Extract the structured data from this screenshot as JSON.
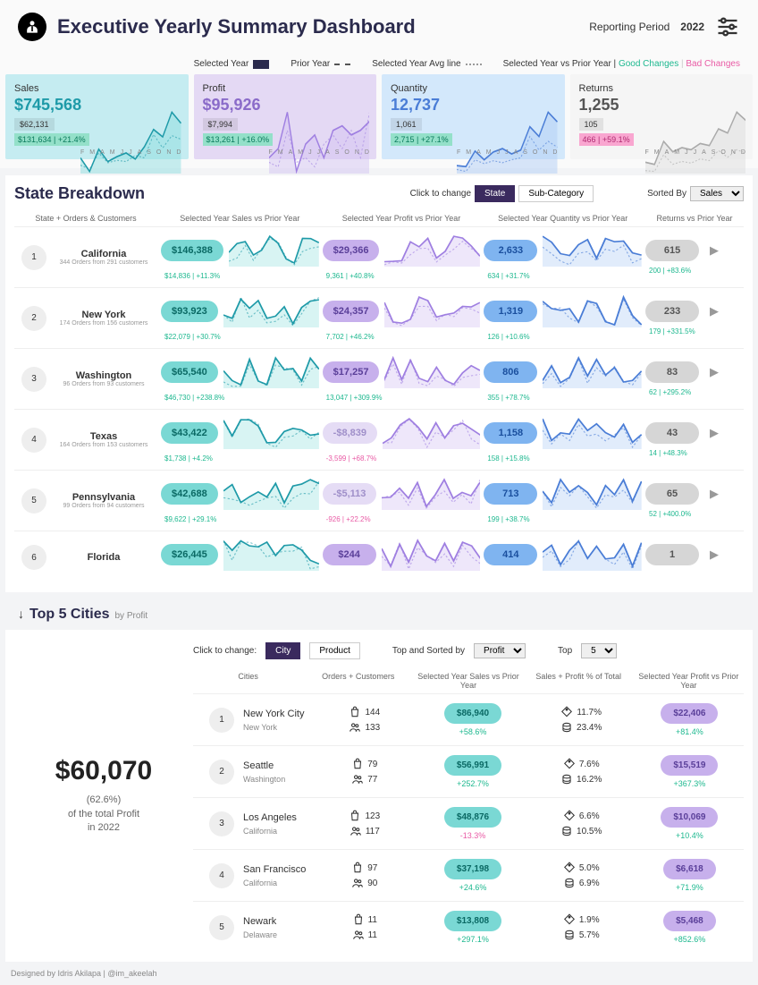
{
  "header": {
    "title": "Executive Yearly Summary Dashboard",
    "period_label": "Reporting Period",
    "period_year": "2022"
  },
  "legend": {
    "sel": "Selected Year",
    "prior": "Prior Year",
    "avg": "Selected Year Avg line",
    "svp_label": "Selected Year vs Prior Year |",
    "good": "Good Changes",
    "bad": "Bad Changes"
  },
  "kpis": {
    "sales": {
      "label": "Sales",
      "value": "$745,568",
      "avg": "$62,131",
      "delta": "$131,634 | +21.4%",
      "delta_good": true,
      "color": "#1e9aa8",
      "area": "#8fdddf"
    },
    "profit": {
      "label": "Profit",
      "value": "$95,926",
      "avg": "$7,994",
      "delta": "$13,261 | +16.0%",
      "delta_good": true,
      "color": "#9f7fe1",
      "area": "#d3c4f2"
    },
    "qty": {
      "label": "Quantity",
      "value": "12,737",
      "avg": "1,061",
      "delta": "2,715 | +27.1%",
      "delta_good": true,
      "color": "#4a7dd6",
      "area": "#b2cef6"
    },
    "ret": {
      "label": "Returns",
      "value": "1,255",
      "avg": "105",
      "delta": "466 | +59.1%",
      "delta_good": false,
      "color": "#aaa",
      "area": "#ddd"
    }
  },
  "chart_data": {
    "kpi_sparklines": {
      "type": "line",
      "months": [
        "J",
        "F",
        "M",
        "A",
        "M",
        "J",
        "J",
        "A",
        "S",
        "O",
        "N",
        "D"
      ],
      "series": {
        "sales": {
          "current": [
            44,
            22,
            58,
            38,
            46,
            52,
            42,
            62,
            90,
            78,
            118,
            100
          ],
          "prior": [
            32,
            26,
            52,
            36,
            40,
            38,
            48,
            44,
            82,
            60,
            80,
            74
          ]
        },
        "profit": {
          "current": [
            4,
            6,
            14,
            1,
            7,
            9,
            4,
            10,
            11,
            9,
            10,
            12
          ],
          "prior": [
            3,
            2,
            10,
            3,
            4,
            2,
            7,
            9,
            6,
            10,
            4,
            14
          ]
        },
        "quantity": {
          "current": [
            600,
            580,
            900,
            720,
            880,
            950,
            840,
            920,
            1400,
            1200,
            1700,
            1500
          ],
          "prior": [
            520,
            480,
            720,
            640,
            700,
            660,
            720,
            760,
            1200,
            920,
            1100,
            980
          ]
        },
        "returns": {
          "current": [
            60,
            55,
            110,
            85,
            95,
            90,
            105,
            100,
            140,
            130,
            180,
            160
          ],
          "prior": [
            40,
            38,
            78,
            55,
            62,
            58,
            68,
            64,
            88,
            72,
            90,
            82
          ]
        }
      }
    },
    "state_rows_sparklines_note": "monthly trends, relative shapes only"
  },
  "breakdown": {
    "title": "State  Breakdown",
    "ctc": "Click to change",
    "opt_state": "State",
    "opt_sub": "Sub-Category",
    "sort_label": "Sorted By",
    "sort_value": "Sales",
    "cols": {
      "c1": "State + Orders & Customers",
      "c2": "Selected Year Sales vs  Prior Year",
      "c3": "Selected Year Profit vs  Prior Year",
      "c4": "Selected Year Quantity vs Prior Year",
      "c5": "Returns vs Prior Year"
    },
    "rows": [
      {
        "rank": "1",
        "name": "California",
        "sub": "344 Orders from 291 customers",
        "sales": "$146,388",
        "sales_d": "$14,836 | +11.3%",
        "sg": true,
        "profit": "$29,366",
        "profit_d": "9,361 | +40.8%",
        "pg": true,
        "qty": "2,633",
        "qty_d": "634 | +31.7%",
        "qg": true,
        "ret": "615",
        "ret_d": "200 | +83.6%",
        "rg": true
      },
      {
        "rank": "2",
        "name": "New York",
        "sub": "174 Orders from 156 customers",
        "sales": "$93,923",
        "sales_d": "$22,079 | +30.7%",
        "sg": true,
        "profit": "$24,357",
        "profit_d": "7,702 | +46.2%",
        "pg": true,
        "qty": "1,319",
        "qty_d": "126 | +10.6%",
        "qg": true,
        "ret": "233",
        "ret_d": "179 | +331.5%",
        "rg": true
      },
      {
        "rank": "3",
        "name": "Washington",
        "sub": "96 Orders from 93 customers",
        "sales": "$65,540",
        "sales_d": "$46,730 | +238.8%",
        "sg": true,
        "profit": "$17,257",
        "profit_d": "13,047 | +309.9%",
        "pg": true,
        "qty": "806",
        "qty_d": "355 | +78.7%",
        "qg": true,
        "ret": "83",
        "ret_d": "62 | +295.2%",
        "rg": true
      },
      {
        "rank": "4",
        "name": "Texas",
        "sub": "164 Orders from 153 customers",
        "sales": "$43,422",
        "sales_d": "$1,738 | +4.2%",
        "sg": true,
        "profit": "-$8,839",
        "profit_d": "-3,599 | +68.7%",
        "pg": false,
        "pn": true,
        "qty": "1,158",
        "qty_d": "158 | +15.8%",
        "qg": true,
        "ret": "43",
        "ret_d": "14 | +48.3%",
        "rg": true
      },
      {
        "rank": "5",
        "name": "Pennsylvania",
        "sub": "99 Orders from 94 customers",
        "sales": "$42,688",
        "sales_d": "$9,622 | +29.1%",
        "sg": true,
        "profit": "-$5,113",
        "profit_d": "-926 | +22.2%",
        "pg": false,
        "pn": true,
        "qty": "713",
        "qty_d": "199 | +38.7%",
        "qg": true,
        "ret": "65",
        "ret_d": "52 | +400.0%",
        "rg": true
      },
      {
        "rank": "6",
        "name": "Florida",
        "sub": "",
        "sales": "$26,445",
        "sales_d": "",
        "sg": true,
        "profit": "$244",
        "profit_d": "",
        "pg": true,
        "qty": "414",
        "qty_d": "",
        "qg": true,
        "ret": "1",
        "ret_d": "",
        "rg": true
      }
    ]
  },
  "top5": {
    "arrow": "↓",
    "title": "Top 5 Cities",
    "by_label": "by Profit",
    "ctc": "Click to change:",
    "opt_city": "City",
    "opt_prod": "Product",
    "sort_label": "Top and Sorted by",
    "sort_value": "Profit",
    "top_label": "Top",
    "top_value": "5",
    "left": {
      "value": "$60,070",
      "pct": "(62.6%)",
      "line2": "of the total Profit",
      "line3": "in  2022"
    },
    "cols": {
      "c1": "Cities",
      "c2": "Orders + Customers",
      "c3": "Selected Year Sales vs Prior Year",
      "c4": "Sales + Profit % of Total",
      "c5": "Selected Year Profit vs Prior Year"
    },
    "rows": [
      {
        "rank": "1",
        "city": "New York City",
        "state": "New York",
        "orders": "144",
        "cust": "133",
        "sales": "$86,940",
        "sd": "+58.6%",
        "sg": true,
        "pct_s": "11.7%",
        "pct_p": "23.4%",
        "profit": "$22,406",
        "pd": "+81.4%",
        "pg": true
      },
      {
        "rank": "2",
        "city": "Seattle",
        "state": "Washington",
        "orders": "79",
        "cust": "77",
        "sales": "$56,991",
        "sd": "+252.7%",
        "sg": true,
        "pct_s": "7.6%",
        "pct_p": "16.2%",
        "profit": "$15,519",
        "pd": "+367.3%",
        "pg": true
      },
      {
        "rank": "3",
        "city": "Los Angeles",
        "state": "California",
        "orders": "123",
        "cust": "117",
        "sales": "$48,876",
        "sd": "-13.3%",
        "sg": false,
        "pct_s": "6.6%",
        "pct_p": "10.5%",
        "profit": "$10,069",
        "pd": "+10.4%",
        "pg": true
      },
      {
        "rank": "4",
        "city": "San Francisco",
        "state": "California",
        "orders": "97",
        "cust": "90",
        "sales": "$37,198",
        "sd": "+24.6%",
        "sg": true,
        "pct_s": "5.0%",
        "pct_p": "6.9%",
        "profit": "$6,618",
        "pd": "+71.9%",
        "pg": true
      },
      {
        "rank": "5",
        "city": "Newark",
        "state": "Delaware",
        "orders": "11",
        "cust": "11",
        "sales": "$13,808",
        "sd": "+297.1%",
        "sg": true,
        "pct_s": "1.9%",
        "pct_p": "5.7%",
        "profit": "$5,468",
        "pd": "+852.6%",
        "pg": true
      }
    ]
  },
  "footer": "Designed by Idris Akilapa | @im_akeelah"
}
